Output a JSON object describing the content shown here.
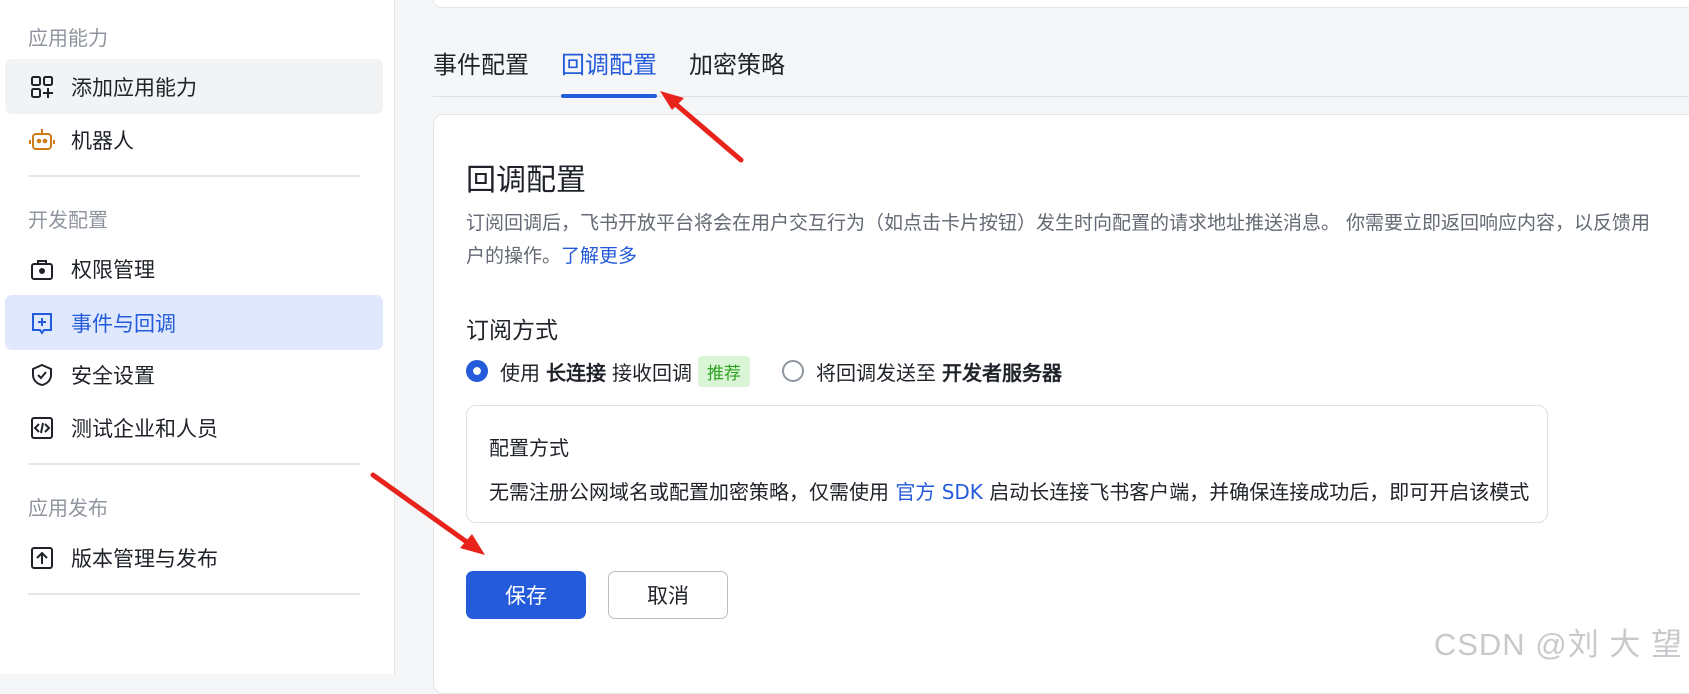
{
  "sidebar": {
    "sections": [
      {
        "title": "应用能力"
      },
      {
        "title": "开发配置"
      },
      {
        "title": "应用发布"
      }
    ],
    "items": [
      {
        "label": "添加应用能力",
        "icon": "add-apps-icon"
      },
      {
        "label": "机器人",
        "icon": "robot-icon"
      },
      {
        "label": "权限管理",
        "icon": "permission-lock-icon"
      },
      {
        "label": "事件与回调",
        "icon": "event-callback-icon"
      },
      {
        "label": "安全设置",
        "icon": "shield-check-icon"
      },
      {
        "label": "测试企业和人员",
        "icon": "code-icon"
      },
      {
        "label": "版本管理与发布",
        "icon": "upload-icon"
      }
    ]
  },
  "tabs": [
    {
      "label": "事件配置"
    },
    {
      "label": "回调配置"
    },
    {
      "label": "加密策略"
    }
  ],
  "card": {
    "title": "回调配置",
    "description": "订阅回调后，飞书开放平台将会在用户交互行为（如点击卡片按钮）发生时向配置的请求地址推送消息。 你需要立即返回响应内容，以反馈用户的操作。",
    "learn_more": "了解更多",
    "subscription_title": "订阅方式",
    "option1": {
      "prefix": "使用",
      "bold": "长连接",
      "suffix": "接收回调",
      "tag": "推荐"
    },
    "option2": {
      "prefix": "将回调发送至",
      "bold": "开发者服务器"
    },
    "config_box": {
      "title": "配置方式",
      "text_before": "无需注册公网域名或配置加密策略，仅需使用",
      "link": "官方 SDK",
      "text_after": "启动长连接飞书客户端，并确保连接成功后，即可开启该模式"
    },
    "save_label": "保存",
    "cancel_label": "取消"
  },
  "watermark": "CSDN @刘 大 望",
  "colors": {
    "accent": "#245bdb",
    "annotation_arrow": "#e8231c",
    "tag_bg": "#d9f5d6"
  }
}
